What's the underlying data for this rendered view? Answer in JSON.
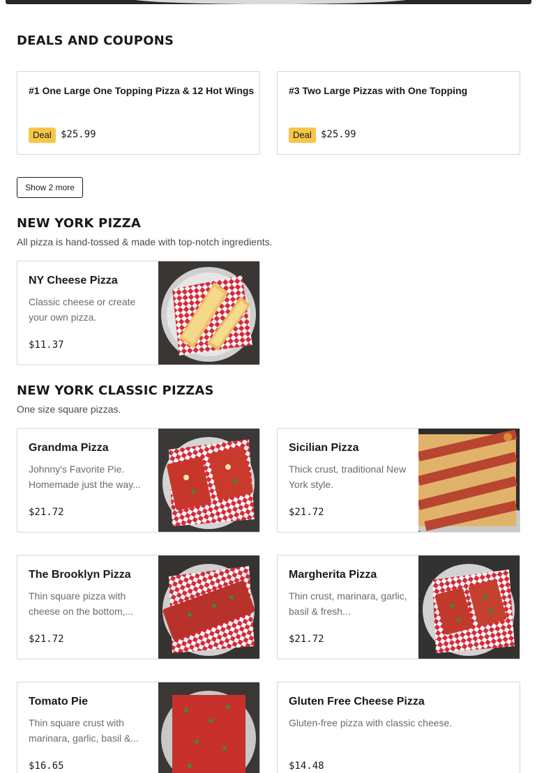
{
  "deals": {
    "title": "DEALS AND COUPONS",
    "items": [
      {
        "title": "#1 One Large One Topping Pizza & 12 Hot Wings",
        "badge": "Deal",
        "price": "$25.99"
      },
      {
        "title": "#3 Two Large Pizzas with One Topping",
        "badge": "Deal",
        "price": "$25.99"
      }
    ],
    "show_more_label": "Show 2 more"
  },
  "ny_pizza": {
    "title": "NEW YORK PIZZA",
    "description": "All pizza is hand-tossed & made with top-notch ingredients.",
    "items": [
      {
        "name": "NY Cheese Pizza",
        "description": "Classic cheese or create your own pizza.",
        "price": "$11.37",
        "photo_icon": "cheese-slices-photo"
      }
    ]
  },
  "ny_classic": {
    "title": "NEW YORK CLASSIC PIZZAS",
    "description": "One size square pizzas.",
    "items": [
      {
        "name": "Grandma Pizza",
        "description": "Johnny's Favorite Pie. Homemade just the way...",
        "price": "$21.72",
        "photo_icon": "grandma-pizza-photo"
      },
      {
        "name": "Sicilian Pizza",
        "description": "Thick crust, traditional New York style.",
        "price": "$21.72",
        "photo_icon": "sicilian-pizza-photo"
      },
      {
        "name": "The Brooklyn Pizza",
        "description": "Thin square pizza with cheese on the bottom,...",
        "price": "$21.72",
        "photo_icon": "brooklyn-pizza-photo"
      },
      {
        "name": "Margherita Pizza",
        "description": "Thin crust, marinara, garlic, basil & fresh...",
        "price": "$21.72",
        "photo_icon": "margherita-pizza-photo"
      },
      {
        "name": "Tomato Pie",
        "description": "Thin square crust with marinara, garlic, basil &...",
        "price": "$16.65",
        "photo_icon": "tomato-pie-photo"
      },
      {
        "name": "Gluten Free Cheese Pizza",
        "description": "Gluten-free pizza with classic cheese.",
        "price": "$14.48"
      }
    ]
  },
  "colors": {
    "deal_badge": "#f7c548",
    "card_border": "#d6d6d6",
    "text_primary": "#191919",
    "text_secondary": "#6b6b6b"
  }
}
